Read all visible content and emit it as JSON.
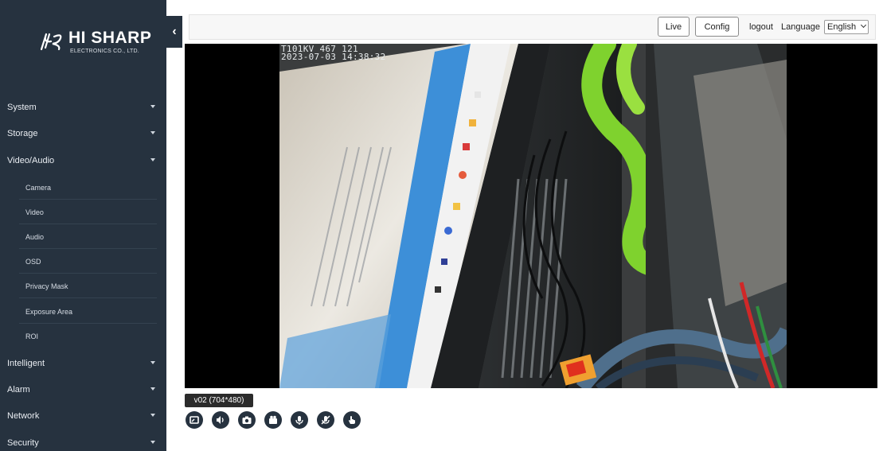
{
  "brand": {
    "logo_mark": "HS",
    "name": "HI SHARP",
    "subtitle": "ELECTRONICS CO., LTD."
  },
  "sidebar": {
    "collapse_icon": "chevron-left-icon",
    "items": [
      {
        "label": "System",
        "expanded": false
      },
      {
        "label": "Storage",
        "expanded": false
      },
      {
        "label": "Video/Audio",
        "expanded": true
      },
      {
        "label": "Intelligent",
        "expanded": false
      },
      {
        "label": "Alarm",
        "expanded": false
      },
      {
        "label": "Network",
        "expanded": false
      },
      {
        "label": "Security",
        "expanded": false
      }
    ],
    "subitems": [
      {
        "label": "Camera"
      },
      {
        "label": "Video"
      },
      {
        "label": "Audio"
      },
      {
        "label": "OSD"
      },
      {
        "label": "Privacy Mask"
      },
      {
        "label": "Exposure Area"
      },
      {
        "label": "ROI"
      }
    ]
  },
  "topbar": {
    "live_label": "Live",
    "config_label": "Config",
    "logout_label": "logout",
    "language_label": "Language",
    "language_value": "English"
  },
  "video": {
    "osd_line1": "T101KV 467 121",
    "osd_line2": "2023-07-03 14:38:32"
  },
  "stream": {
    "label": "v02 (704*480)"
  },
  "controls": [
    {
      "icon": "fullscreen-icon"
    },
    {
      "icon": "speaker-icon"
    },
    {
      "icon": "snapshot-camera-icon"
    },
    {
      "icon": "record-video-icon"
    },
    {
      "icon": "intercom-mic-icon"
    },
    {
      "icon": "mute-mic-icon"
    },
    {
      "icon": "ptz-hand-icon"
    }
  ],
  "colors": {
    "sidebar_bg": "#26323f",
    "control_bg": "#26323f",
    "video_bg": "#000000"
  }
}
